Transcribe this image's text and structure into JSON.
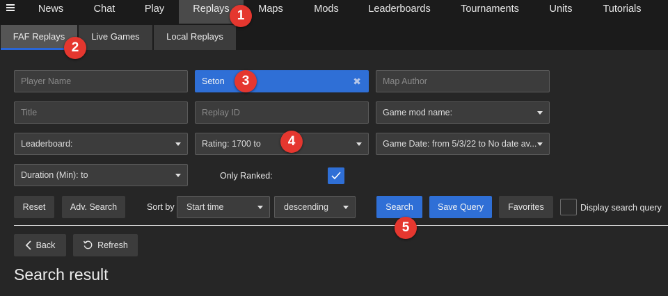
{
  "nav": {
    "tabs": [
      {
        "label": "News"
      },
      {
        "label": "Chat"
      },
      {
        "label": "Play"
      },
      {
        "label": "Replays"
      },
      {
        "label": "Maps"
      },
      {
        "label": "Mods"
      },
      {
        "label": "Leaderboards"
      },
      {
        "label": "Tournaments"
      },
      {
        "label": "Units"
      },
      {
        "label": "Tutorials"
      }
    ],
    "active_tab": "Replays"
  },
  "subnav": {
    "tabs": [
      {
        "label": "FAF Replays"
      },
      {
        "label": "Live Games"
      },
      {
        "label": "Local Replays"
      }
    ],
    "active_tab": "FAF Replays",
    "accent_color": "#2a66d6"
  },
  "search": {
    "player_name": {
      "placeholder": "Player Name",
      "value": ""
    },
    "player_name_filled": {
      "value": "Seton"
    },
    "map_author": {
      "placeholder": "Map Author",
      "value": ""
    },
    "title": {
      "placeholder": "Title",
      "value": ""
    },
    "replay_id": {
      "placeholder": "Replay ID",
      "value": ""
    },
    "game_mod": {
      "value": "Game mod name:"
    },
    "leaderboard": {
      "value": "Leaderboard:"
    },
    "rating": {
      "value": "Rating: 1700 to"
    },
    "game_date": {
      "value": "Game Date: from 5/3/22 to No date av..."
    },
    "duration": {
      "value": "Duration (Min):  to"
    },
    "only_ranked": {
      "label": "Only Ranked:",
      "checked": true
    },
    "reset_label": "Reset",
    "adv_search_label": "Adv. Search",
    "sort_by_label": "Sort by",
    "sort_field": "Start time",
    "sort_order": "descending",
    "search_label": "Search",
    "save_query_label": "Save Query",
    "favorites_label": "Favorites",
    "display_query": {
      "label": "Display search query",
      "checked": false
    }
  },
  "results": {
    "back_label": "Back",
    "refresh_label": "Refresh",
    "heading": "Search result"
  },
  "badges": [
    "1",
    "2",
    "3",
    "4",
    "5"
  ],
  "colors": {
    "accent": "#2f6fd6",
    "badge": "#e5372f",
    "background": "#262626",
    "nav_background": "#1b1b1b"
  }
}
